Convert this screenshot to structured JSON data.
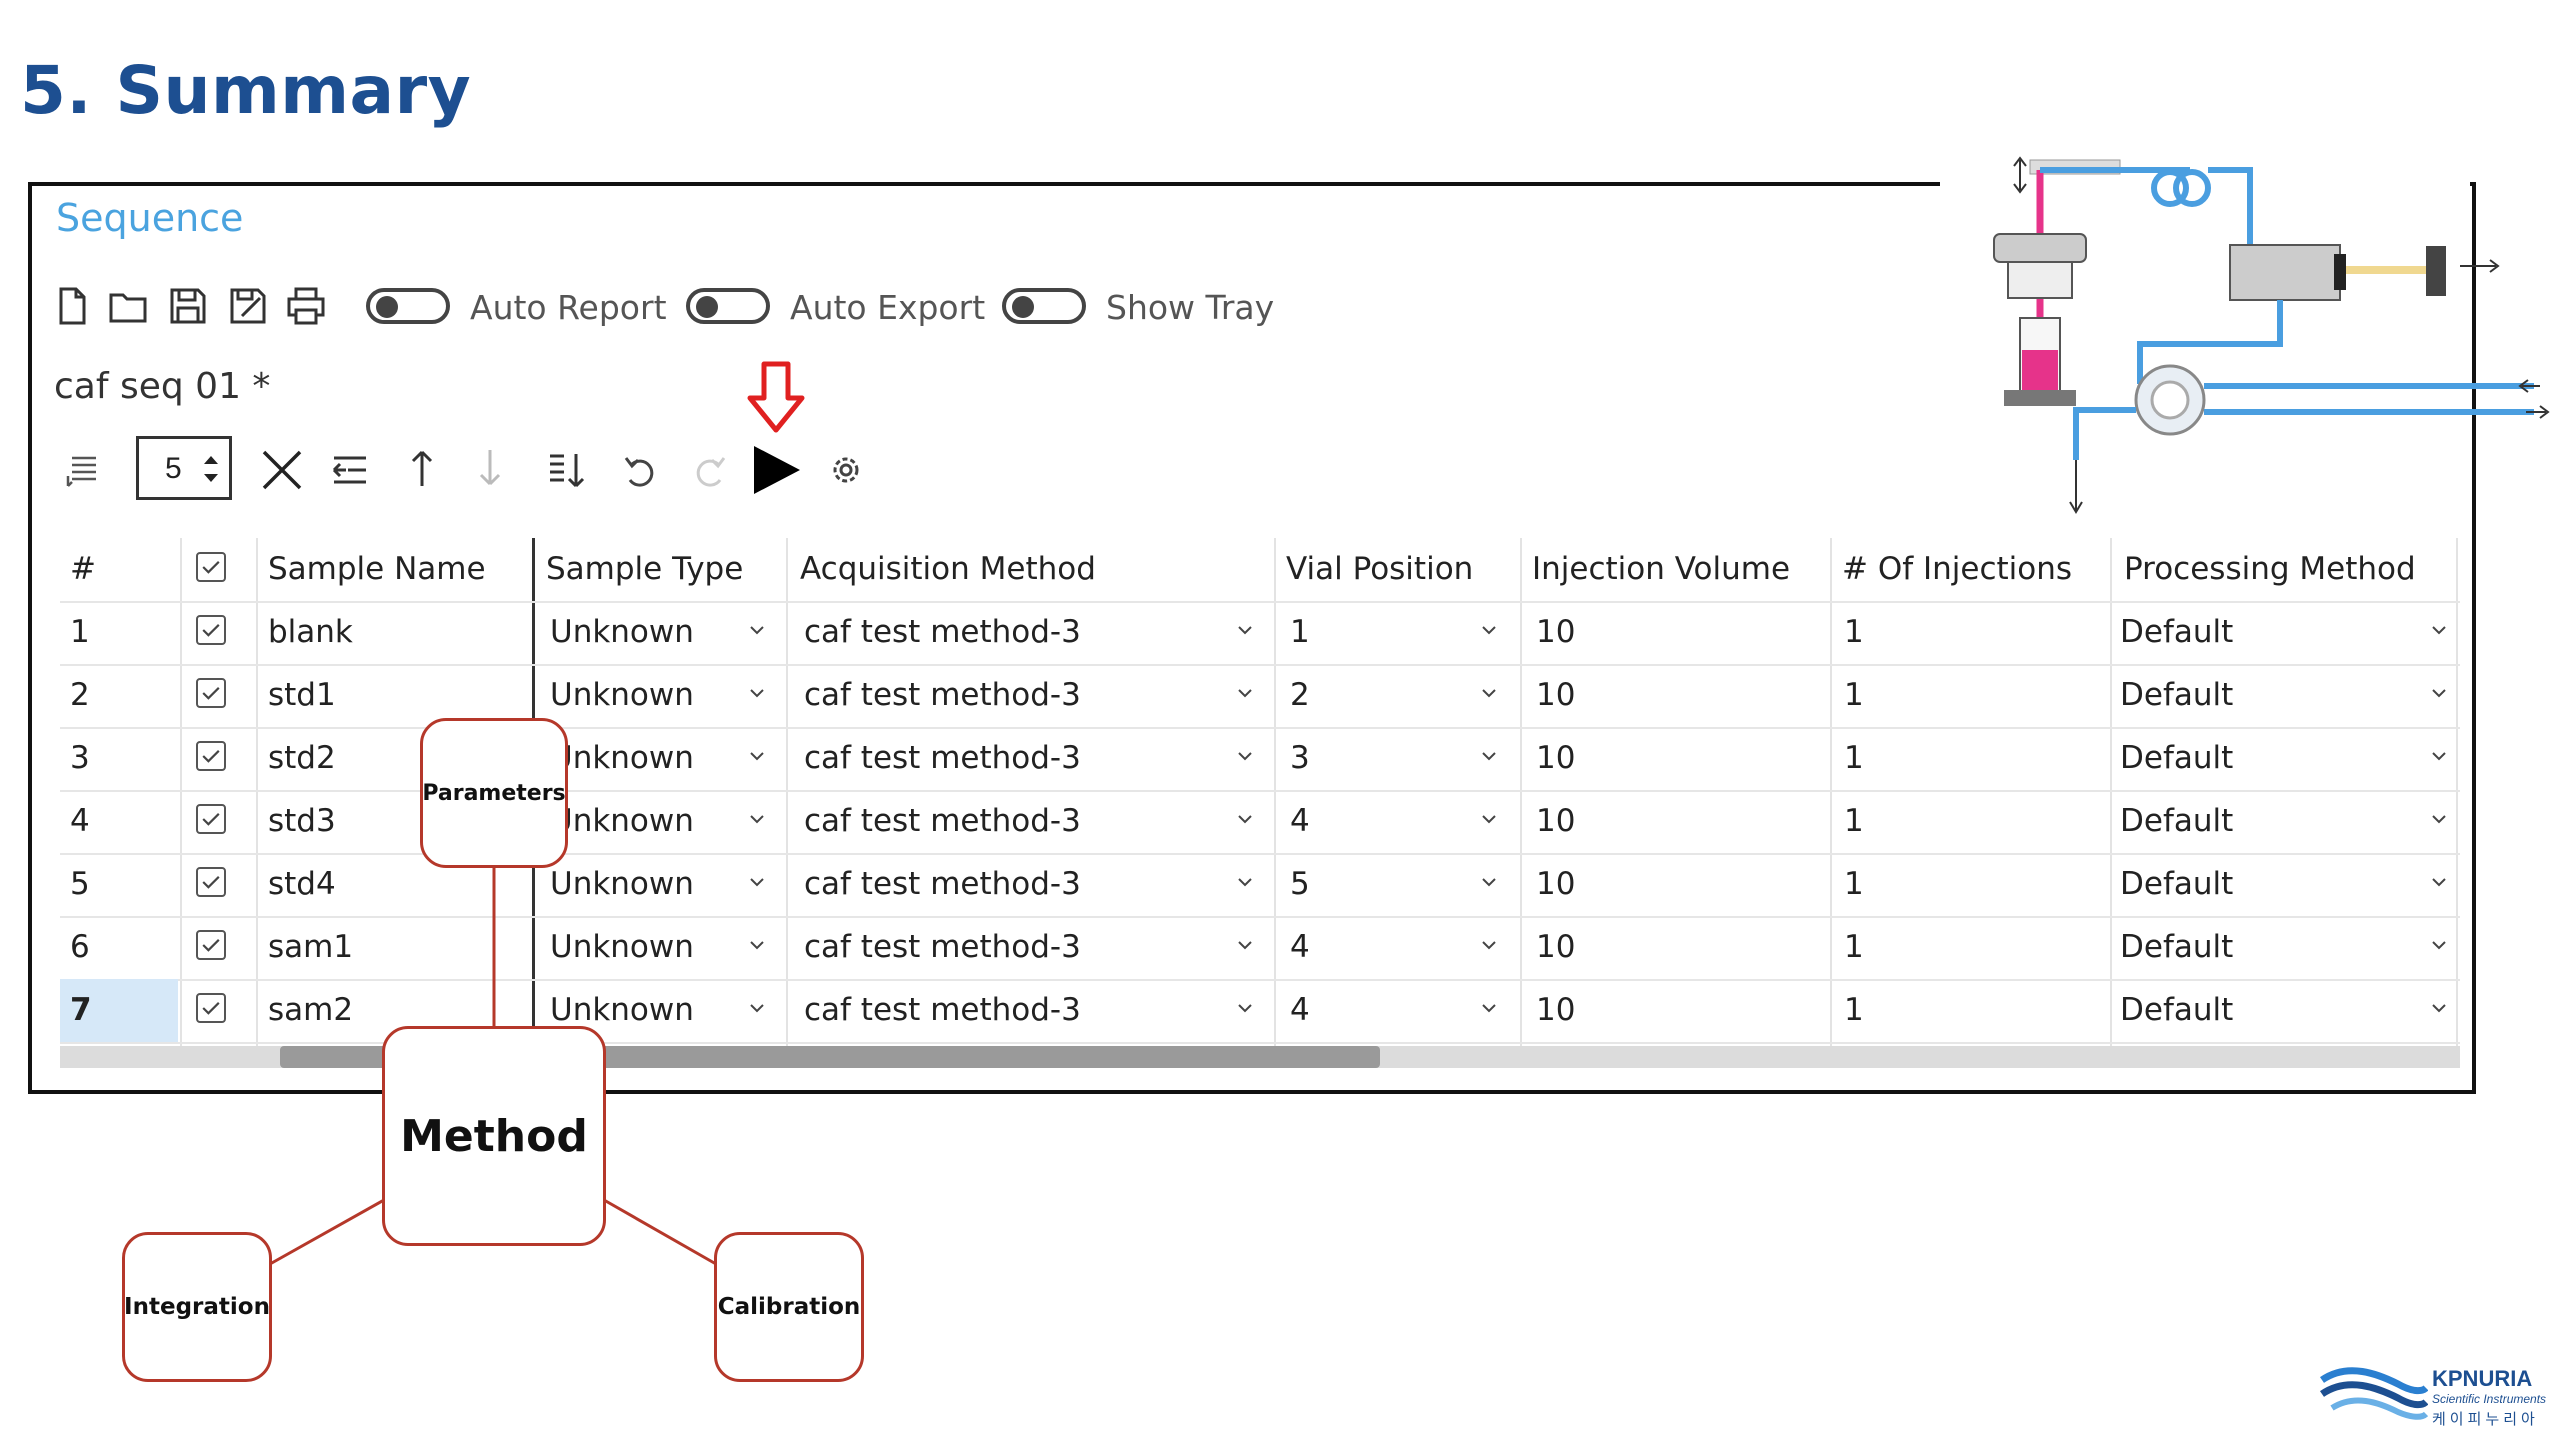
{
  "slide": {
    "title": "5. Summary"
  },
  "window": {
    "heading": "Sequence",
    "sequence_name": "caf seq 01 *"
  },
  "toolbar": {
    "toggles": [
      {
        "label": "Auto Report",
        "on": false
      },
      {
        "label": "Auto Export",
        "on": false
      },
      {
        "label": "Show Tray",
        "on": false
      }
    ],
    "row_count": "5",
    "icons": [
      "new-file-icon",
      "open-folder-icon",
      "save-icon",
      "save-as-icon",
      "print-icon"
    ],
    "edit_icons": [
      "insert-rows-icon",
      "delete-icon",
      "outdent-icon",
      "move-up-icon",
      "move-down-icon",
      "fill-down-icon",
      "undo-icon",
      "redo-icon",
      "run-icon",
      "settings-icon"
    ]
  },
  "table": {
    "headers": [
      "#",
      "",
      "Sample Name",
      "Sample Type",
      "Acquisition Method",
      "Vial Position",
      "Injection Volume",
      "# Of Injections",
      "Processing Method"
    ],
    "rows": [
      {
        "num": "1",
        "name": "blank",
        "type": "Unknown",
        "method": "caf test method-3",
        "vial": "1",
        "volume": "10",
        "injections": "1",
        "processing": "Default"
      },
      {
        "num": "2",
        "name": "std1",
        "type": "Unknown",
        "method": "caf test method-3",
        "vial": "2",
        "volume": "10",
        "injections": "1",
        "processing": "Default"
      },
      {
        "num": "3",
        "name": "std2",
        "type": "Unknown",
        "method": "caf test method-3",
        "vial": "3",
        "volume": "10",
        "injections": "1",
        "processing": "Default"
      },
      {
        "num": "4",
        "name": "std3",
        "type": "Unknown",
        "method": "caf test method-3",
        "vial": "4",
        "volume": "10",
        "injections": "1",
        "processing": "Default"
      },
      {
        "num": "5",
        "name": "std4",
        "type": "Unknown",
        "method": "caf test method-3",
        "vial": "5",
        "volume": "10",
        "injections": "1",
        "processing": "Default"
      },
      {
        "num": "6",
        "name": "sam1",
        "type": "Unknown",
        "method": "caf test method-3",
        "vial": "4",
        "volume": "10",
        "injections": "1",
        "processing": "Default"
      },
      {
        "num": "7",
        "name": "sam2",
        "type": "Unknown",
        "method": "caf test method-3",
        "vial": "4",
        "volume": "10",
        "injections": "1",
        "processing": "Default"
      }
    ]
  },
  "mindmap": {
    "center": "Method",
    "top": "Parameters",
    "left": "Integration",
    "right": "Calibration"
  },
  "logo": {
    "name": "KPNURIA",
    "tagline": "Scientific Instruments",
    "korean": "케이피누리아"
  },
  "colors": {
    "title": "#1d4f91",
    "heading": "#4aa3df",
    "node_border": "#b5382a",
    "arrow": "#e02020",
    "tube_blue": "#4a9ee0",
    "sample_pink": "#e6338a"
  }
}
